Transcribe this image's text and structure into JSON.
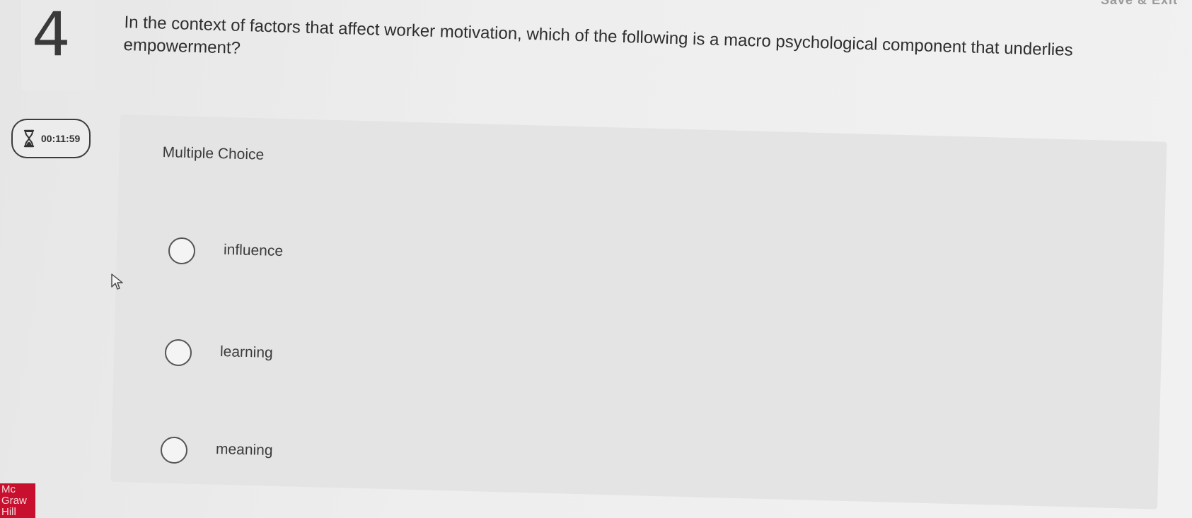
{
  "header": {
    "save_exit_label": "Save & Exit"
  },
  "question": {
    "number": "4",
    "text": "In the context of factors that affect worker motivation, which of the following is a macro psychological component that underlies empowerment?"
  },
  "timer": {
    "icon": "hourglass-icon",
    "value": "00:11:59"
  },
  "answer": {
    "type_label": "Multiple Choice",
    "options": [
      {
        "label": "influence"
      },
      {
        "label": "learning"
      },
      {
        "label": "meaning"
      }
    ]
  },
  "brand": {
    "logo_lines": [
      "Mc",
      "Graw",
      "Hill"
    ],
    "color": "#c8102e"
  }
}
